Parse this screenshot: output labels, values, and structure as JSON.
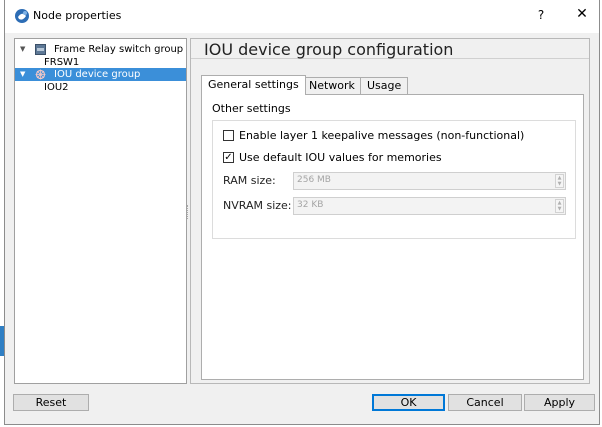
{
  "window": {
    "title": "Node properties",
    "help_label": "?",
    "close_label": "✕"
  },
  "tree": {
    "groups": [
      {
        "label": "Frame Relay switch group",
        "children": [
          "FRSW1"
        ],
        "selected": false
      },
      {
        "label": "IOU device group",
        "children": [
          "IOU2"
        ],
        "selected": true
      }
    ]
  },
  "page": {
    "title": "IOU device group configuration",
    "tabs": [
      {
        "label": "General settings",
        "active": true
      },
      {
        "label": "Network",
        "active": false
      },
      {
        "label": "Usage",
        "active": false
      }
    ],
    "section_title": "Other settings",
    "checkboxes": [
      {
        "label": "Enable layer 1 keepalive messages (non-functional)",
        "checked": false
      },
      {
        "label": "Use default IOU values for memories",
        "checked": true
      }
    ],
    "fields": [
      {
        "label": "RAM size:",
        "value": "256 MB"
      },
      {
        "label": "NVRAM size:",
        "value": "32 KB"
      }
    ]
  },
  "buttons": {
    "reset": "Reset",
    "ok": "OK",
    "cancel": "Cancel",
    "apply": "Apply"
  },
  "colors": {
    "selection": "#3b8fd9",
    "default_button_border": "#0078d7",
    "dialog_background": "#f0f0f0"
  }
}
